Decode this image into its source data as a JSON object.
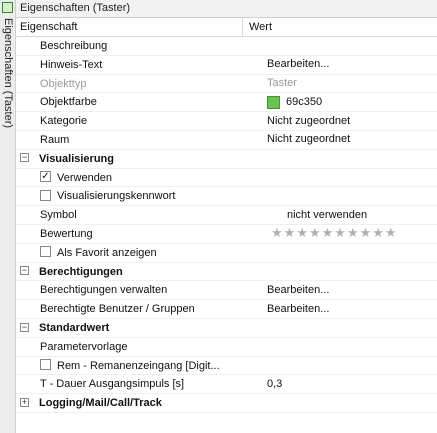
{
  "side_tab": {
    "label": "Eigenschaften (Taster)"
  },
  "panel": {
    "title": "Eigenschaften (Taster)"
  },
  "columns": {
    "property": "Eigenschaft",
    "value": "Wert"
  },
  "colors": {
    "object_color": "#69c350"
  },
  "general": {
    "beschreibung": {
      "label": "Beschreibung",
      "value": ""
    },
    "hinweis": {
      "label": "Hinweis-Text",
      "value": "Bearbeiten..."
    },
    "objekttyp": {
      "label": "Objekttyp",
      "value": "Taster"
    },
    "objektfarbe": {
      "label": "Objektfarbe",
      "value": "69c350"
    },
    "kategorie": {
      "label": "Kategorie",
      "value": "Nicht zugeordnet"
    },
    "raum": {
      "label": "Raum",
      "value": "Nicht zugeordnet"
    }
  },
  "visualisierung": {
    "title": "Visualisierung",
    "expander": "⊟",
    "verwenden": {
      "label": "Verwenden",
      "checked": true,
      "mark": "✓"
    },
    "kennwort": {
      "label": "Visualisierungskennwort",
      "checked": false
    },
    "symbol": {
      "label": "Symbol",
      "value": "nicht verwenden"
    },
    "bewertung": {
      "label": "Bewertung",
      "stars_total": 10,
      "stars_filled": 0,
      "star_glyph": "★"
    },
    "favorit": {
      "label": "Als Favorit anzeigen",
      "checked": false
    }
  },
  "berechtigungen": {
    "title": "Berechtigungen",
    "expander": "⊟",
    "verwalten": {
      "label": "Berechtigungen verwalten",
      "value": "Bearbeiten..."
    },
    "benutzer": {
      "label": "Berechtigte Benutzer / Gruppen",
      "value": "Bearbeiten..."
    }
  },
  "standardwert": {
    "title": "Standardwert",
    "expander": "⊟",
    "parametervorlage": {
      "label": "Parametervorlage",
      "value": ""
    },
    "rem": {
      "label": "Rem - Remanenzeingang [Digit...",
      "checked": false
    },
    "dauer": {
      "label": "T - Dauer Ausgangsimpuls [s]",
      "value": "0,3"
    }
  },
  "logging": {
    "title": "Logging/Mail/Call/Track",
    "expander": "⊞"
  }
}
